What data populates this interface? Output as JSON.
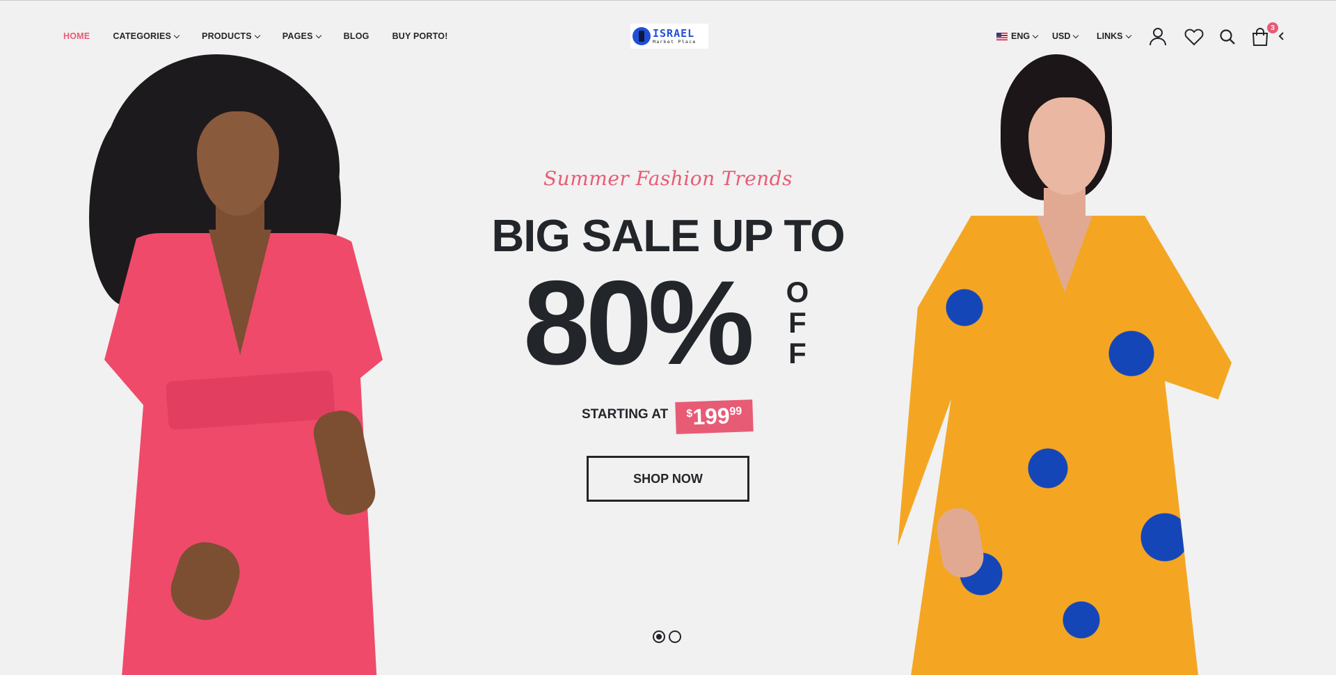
{
  "nav": {
    "items": [
      {
        "label": "HOME",
        "active": true,
        "dropdown": false
      },
      {
        "label": "CATEGORIES",
        "active": false,
        "dropdown": true
      },
      {
        "label": "PRODUCTS",
        "active": false,
        "dropdown": true
      },
      {
        "label": "PAGES",
        "active": false,
        "dropdown": true
      },
      {
        "label": "BLOG",
        "active": false,
        "dropdown": false
      },
      {
        "label": "BUY PORTO!",
        "active": false,
        "dropdown": false
      }
    ]
  },
  "logo": {
    "title": "ISRAEL",
    "subtitle": "Market Place"
  },
  "tools": {
    "language": "ENG",
    "currency": "USD",
    "links": "LINKS",
    "cart_count": "3",
    "icons": [
      "user-icon",
      "heart-icon",
      "search-icon",
      "cart-icon",
      "chevron-left-icon"
    ]
  },
  "hero": {
    "subtitle": "Summer Fashion Trends",
    "headline": "BIG SALE UP TO",
    "percent": "80%",
    "off_letters": [
      "O",
      "F",
      "F"
    ],
    "starting_label": "STARTING AT",
    "price_currency": "$",
    "price_main": "199",
    "price_cents": "99",
    "button_label": "SHOP NOW",
    "slides_total": 2,
    "slide_active": 1
  },
  "colors": {
    "accent": "#e85b75",
    "text": "#222529",
    "background": "#f1f1f1"
  }
}
